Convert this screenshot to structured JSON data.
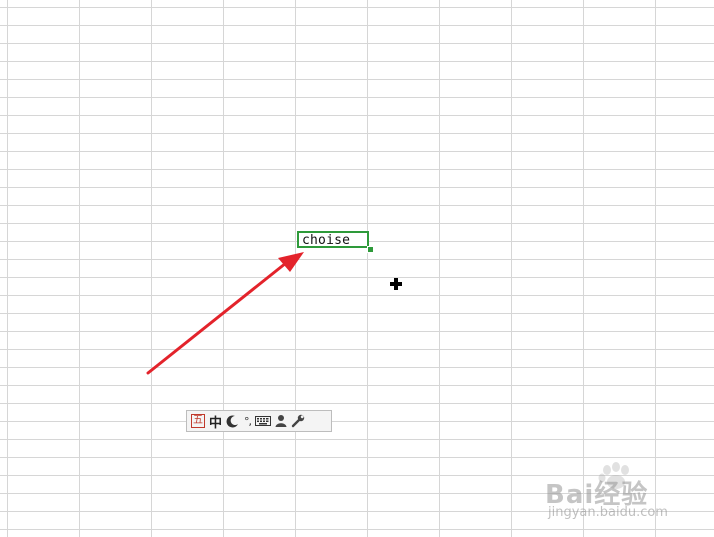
{
  "spreadsheet": {
    "active_cell_value": "choise"
  },
  "ime_toolbar": {
    "logo_char": "五",
    "language_mode": "中",
    "punctuation_mode": "°,",
    "icons": [
      "wubi-logo-icon",
      "chinese-mode-icon",
      "half-width-moon-icon",
      "punctuation-icon",
      "keyboard-icon",
      "user-icon",
      "wrench-icon"
    ]
  },
  "watermark": {
    "brand": "Bai经验",
    "url": "jingyan.baidu.com"
  },
  "colors": {
    "selection": "#2e9a3a",
    "annotation_arrow": "#e3232b",
    "gridline": "#d6d6d6"
  }
}
